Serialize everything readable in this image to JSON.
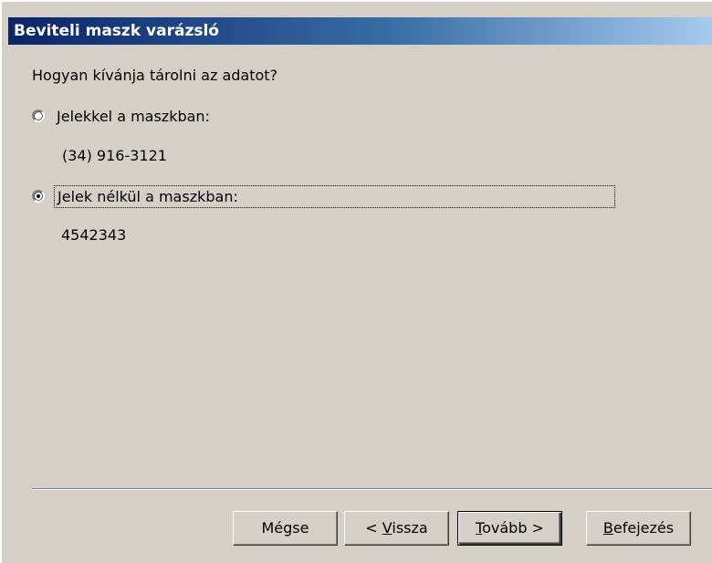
{
  "window": {
    "title": "Beviteli maszk varázsló"
  },
  "question": "Hogyan kívánja tárolni az adatot?",
  "options": [
    {
      "label": "Jelekkel a maszkban:",
      "sample": "(34) 916-3121",
      "selected": false
    },
    {
      "label": "Jelek nélkül a maszkban:",
      "sample": "4542343",
      "selected": true
    }
  ],
  "buttons": {
    "cancel": "Mégse",
    "back_prefix": "< ",
    "back_key": "V",
    "back_rest": "issza",
    "next_key": "T",
    "next_rest": "ovább >",
    "finish_key": "B",
    "finish_rest": "efejezés"
  },
  "colors": {
    "titlebar_start": "#0a246a",
    "titlebar_end": "#a6caf0",
    "dialog_bg": "#d4d0c8"
  }
}
